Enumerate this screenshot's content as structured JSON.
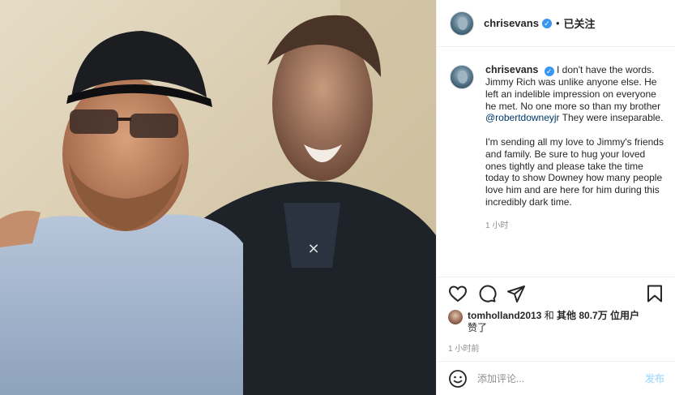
{
  "header": {
    "username": "chrisevans",
    "verified_mark": "✓",
    "separator": "•",
    "follow_status": "已关注"
  },
  "caption": {
    "username": "chrisevans",
    "paragraph1_before": "I don't have the words. Jimmy Rich was unlike anyone else. He left an indelible impression on everyone he met. No one more so than my brother ",
    "mention": "@robertdowneyjr",
    "paragraph1_after": " They were inseparable.",
    "paragraph2": "I'm sending all my love to Jimmy's friends and family. Be sure to hug your loved ones tightly and please take the time today to show Downey how many people love him and are here for him during this incredibly dark time.",
    "time": "1 小时"
  },
  "actions": {
    "icons": [
      "heart-icon",
      "comment-icon",
      "share-icon",
      "bookmark-icon"
    ]
  },
  "likes": {
    "user": "tomholland2013",
    "connector": " 和 ",
    "others": "其他 80.7万 位用户",
    "suffix": "赞了"
  },
  "post_time": "1 小时前",
  "comment_box": {
    "placeholder": "添加评论...",
    "publish_label": "发布"
  },
  "colors": {
    "verified": "#3897f0",
    "mention": "#00376b",
    "publish_disabled": "#b2dffc",
    "muted": "#8e8e8e"
  }
}
